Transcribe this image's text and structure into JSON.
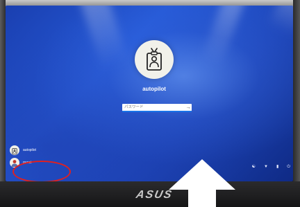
{
  "login": {
    "username": "autopilot",
    "password_placeholder": "パスワード",
    "submit_glyph": "→"
  },
  "user_pods": [
    {
      "name": "autopilot"
    },
    {
      "name": "guest"
    }
  ],
  "shelf": {
    "icons": [
      "accessibility-icon",
      "wifi-icon",
      "battery-icon",
      "power-icon"
    ]
  },
  "device": {
    "brand": "ASUS"
  },
  "colors": {
    "screen_blue": "#2559d6",
    "annotation_red": "#e02020",
    "arrow_white": "#ffffff",
    "input_focus": "#1a73e8"
  }
}
